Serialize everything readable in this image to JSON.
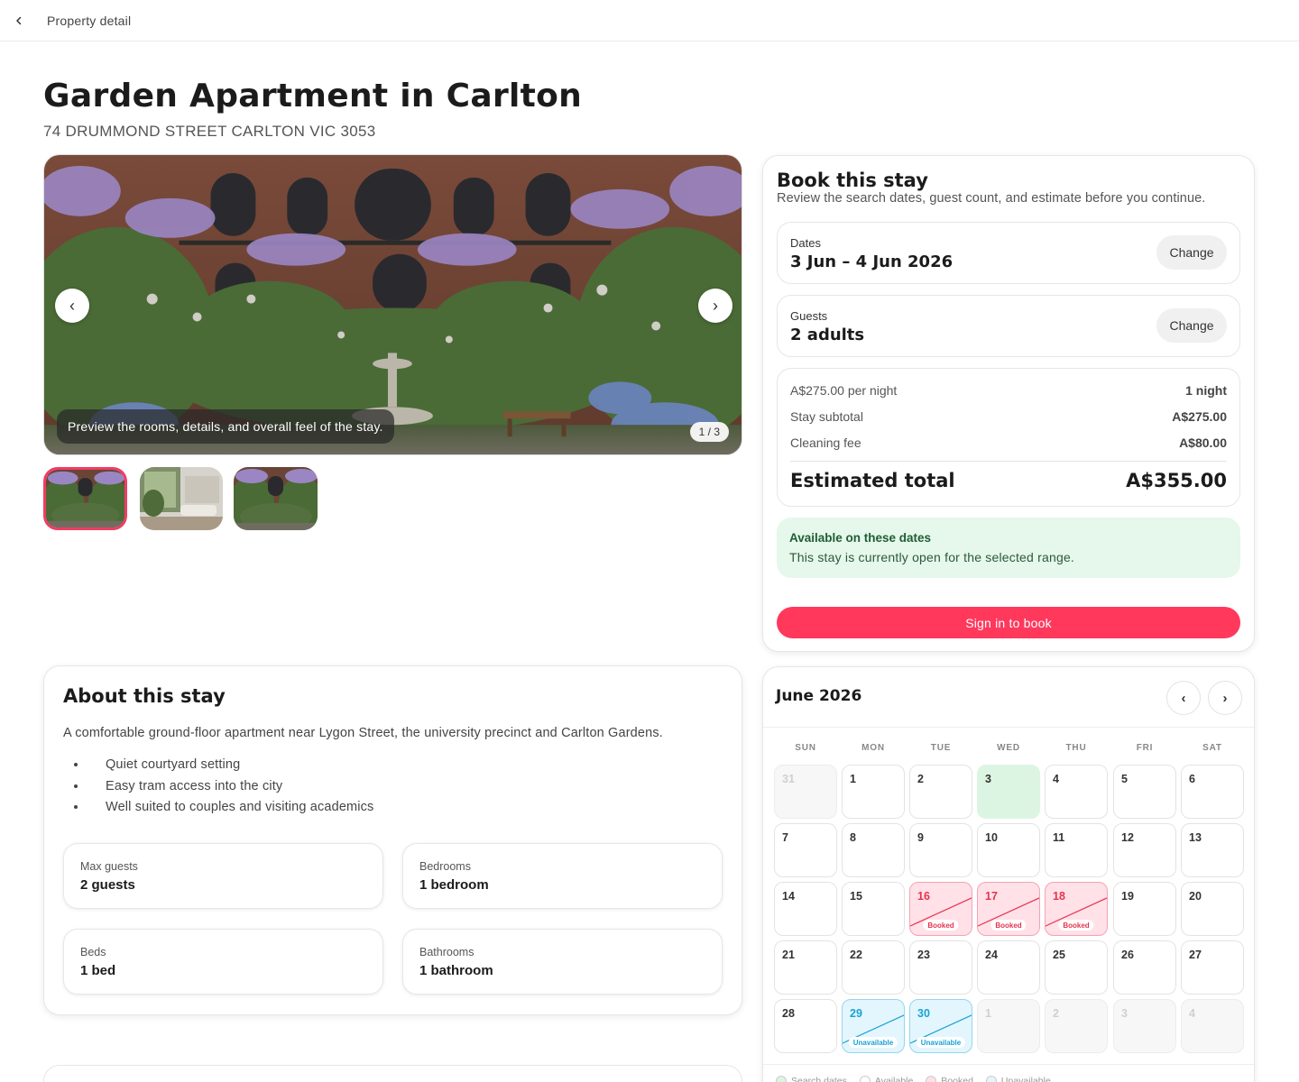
{
  "topbar": {
    "title": "Property detail"
  },
  "property": {
    "title": "Garden Apartment in Carlton",
    "address": "74 DRUMMOND STREET CARLTON VIC 3053"
  },
  "gallery": {
    "caption": "Preview the rooms, details, and overall feel of the stay.",
    "counter": "1 / 3",
    "prev_label": "‹",
    "next_label": "›"
  },
  "booking": {
    "title": "Book this stay",
    "subtitle": "Review the search dates, guest count, and estimate before you continue.",
    "dates_label": "Dates",
    "dates_value": "3 Jun – 4 Jun 2026",
    "guests_label": "Guests",
    "guests_value": "2 adults",
    "change_label": "Change",
    "price": {
      "rows": [
        {
          "label": "A$275.00 per night",
          "value": "1 night"
        },
        {
          "label": "Stay subtotal",
          "value": "A$275.00"
        },
        {
          "label": "Cleaning fee",
          "value": "A$80.00"
        }
      ],
      "total_label": "Estimated total",
      "total_value": "A$355.00"
    },
    "availability_title": "Available on these dates",
    "availability_text": "This stay is currently open for the selected range.",
    "signin_label": "Sign in to book",
    "accent_color": "#ff385c"
  },
  "about": {
    "title": "About this stay",
    "description": "A comfortable ground-floor apartment near Lygon Street, the university precinct and Carlton Gardens.",
    "highlights": [
      "Quiet courtyard setting",
      "Easy tram access into the city",
      "Well suited to couples and visiting academics"
    ],
    "stats": [
      {
        "label": "Max guests",
        "value": "2 guests"
      },
      {
        "label": "Bedrooms",
        "value": "1 bedroom"
      },
      {
        "label": "Beds",
        "value": "1 bed"
      },
      {
        "label": "Bathrooms",
        "value": "1 bathroom"
      }
    ]
  },
  "calendar": {
    "month": "June 2026",
    "prev_label": "‹",
    "next_label": "›",
    "weekdays": [
      "SUN",
      "MON",
      "TUE",
      "WED",
      "THU",
      "FRI",
      "SAT"
    ],
    "booked_tag": "Booked",
    "unavailable_tag": "Unavailable",
    "days": [
      {
        "n": "31",
        "s": "muted"
      },
      {
        "n": "1",
        "s": ""
      },
      {
        "n": "2",
        "s": ""
      },
      {
        "n": "3",
        "s": "selected"
      },
      {
        "n": "4",
        "s": ""
      },
      {
        "n": "5",
        "s": ""
      },
      {
        "n": "6",
        "s": ""
      },
      {
        "n": "7",
        "s": ""
      },
      {
        "n": "8",
        "s": ""
      },
      {
        "n": "9",
        "s": ""
      },
      {
        "n": "10",
        "s": ""
      },
      {
        "n": "11",
        "s": ""
      },
      {
        "n": "12",
        "s": ""
      },
      {
        "n": "13",
        "s": ""
      },
      {
        "n": "14",
        "s": ""
      },
      {
        "n": "15",
        "s": ""
      },
      {
        "n": "16",
        "s": "booked"
      },
      {
        "n": "17",
        "s": "booked"
      },
      {
        "n": "18",
        "s": "booked"
      },
      {
        "n": "19",
        "s": ""
      },
      {
        "n": "20",
        "s": ""
      },
      {
        "n": "21",
        "s": ""
      },
      {
        "n": "22",
        "s": ""
      },
      {
        "n": "23",
        "s": ""
      },
      {
        "n": "24",
        "s": ""
      },
      {
        "n": "25",
        "s": ""
      },
      {
        "n": "26",
        "s": ""
      },
      {
        "n": "27",
        "s": ""
      },
      {
        "n": "28",
        "s": ""
      },
      {
        "n": "29",
        "s": "unavail"
      },
      {
        "n": "30",
        "s": "unavail"
      },
      {
        "n": "1",
        "s": "muted"
      },
      {
        "n": "2",
        "s": "muted"
      },
      {
        "n": "3",
        "s": "muted"
      },
      {
        "n": "4",
        "s": "muted"
      }
    ],
    "legend": [
      {
        "label": "Search dates",
        "color": "#dcf5e3"
      },
      {
        "label": "Available",
        "color": "#ffffff"
      },
      {
        "label": "Booked",
        "color": "#ffe1e7"
      },
      {
        "label": "Unavailable",
        "color": "#e3f6fd"
      }
    ]
  }
}
